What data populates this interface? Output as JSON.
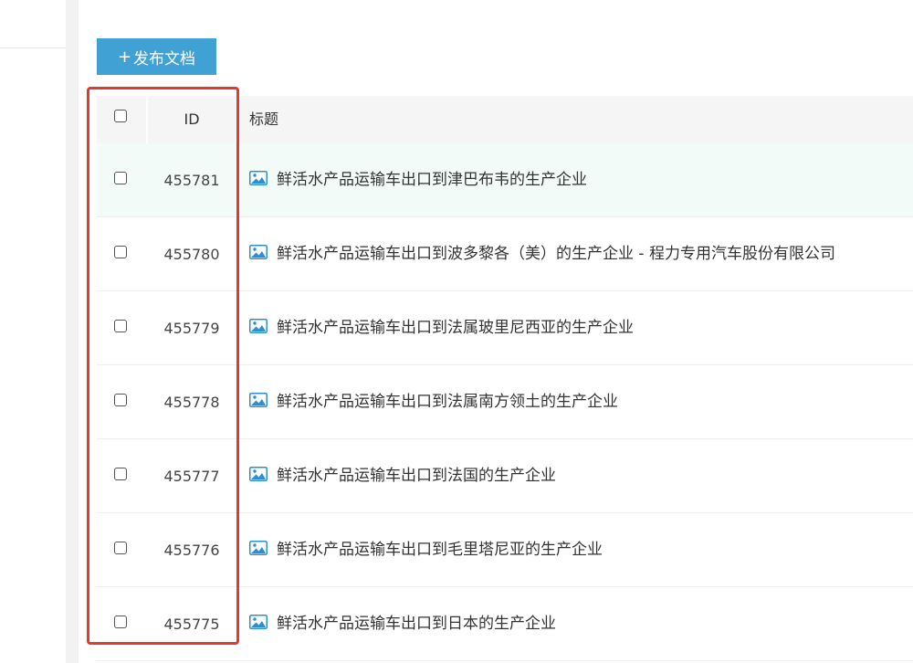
{
  "toolbar": {
    "publish_plus": "+",
    "publish_label": "发布文档"
  },
  "table": {
    "headers": {
      "id": "ID",
      "title": "标题"
    },
    "rows": [
      {
        "id": "455781",
        "title": "鲜活水产品运输车出口到津巴布韦的生产企业"
      },
      {
        "id": "455780",
        "title": "鲜活水产品运输车出口到波多黎各（美）的生产企业 - 程力专用汽车股份有限公司"
      },
      {
        "id": "455779",
        "title": "鲜活水产品运输车出口到法属玻里尼西亚的生产企业"
      },
      {
        "id": "455778",
        "title": "鲜活水产品运输车出口到法属南方领土的生产企业"
      },
      {
        "id": "455777",
        "title": "鲜活水产品运输车出口到法国的生产企业"
      },
      {
        "id": "455776",
        "title": "鲜活水产品运输车出口到毛里塔尼亚的生产企业"
      },
      {
        "id": "455775",
        "title": "鲜活水产品运输车出口到日本的生产企业"
      }
    ]
  },
  "colors": {
    "accent": "#3fa1d4",
    "highlight": "#e23a2e",
    "row_hover": "#f3fbf9"
  },
  "icons": {
    "row_icon": "image-icon",
    "checkbox": "checkbox-icon"
  }
}
